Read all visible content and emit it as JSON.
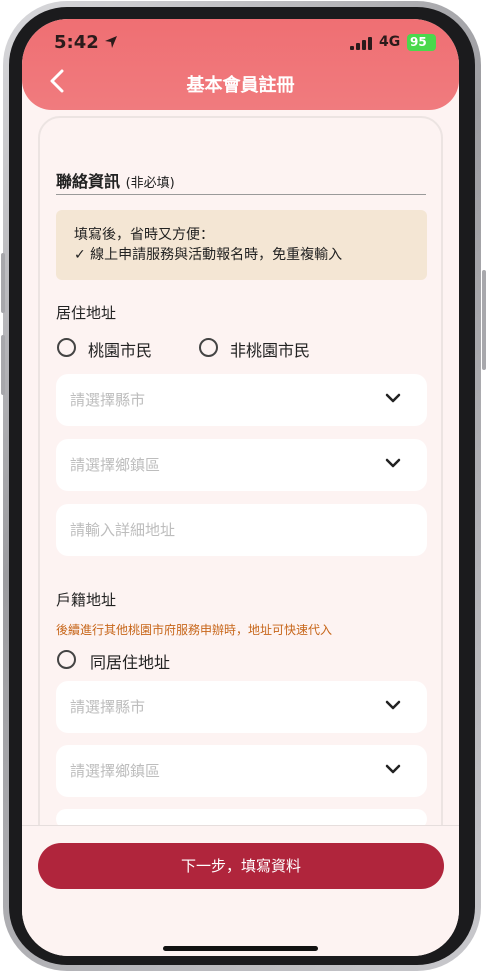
{
  "status_bar": {
    "time": "5:42",
    "network": "4G",
    "battery": "95"
  },
  "header": {
    "title": "基本會員註冊"
  },
  "contact_section": {
    "title": "聯絡資訊",
    "optional_note": "(非必填)"
  },
  "info_box": {
    "line1": "填寫後，省時又方便：",
    "line2": "✓ 線上申請服務與活動報名時，免重複輸入"
  },
  "residence": {
    "label": "居住地址",
    "options": [
      "桃園市民",
      "非桃園市民"
    ],
    "city_placeholder": "請選擇縣市",
    "district_placeholder": "請選擇鄉鎮區",
    "address_placeholder": "請輸入詳細地址"
  },
  "household": {
    "label": "戶籍地址",
    "hint": "後續進行其他桃園市府服務申辦時，地址可快速代入",
    "same_option": "同居住地址",
    "city_placeholder": "請選擇縣市",
    "district_placeholder": "請選擇鄉鎮區"
  },
  "footer": {
    "next_label": "下一步，填寫資料"
  },
  "colors": {
    "header": "#ef6f73",
    "button": "#b0253c",
    "hint": "#c7661a",
    "info_bg": "#f4e6d4"
  }
}
